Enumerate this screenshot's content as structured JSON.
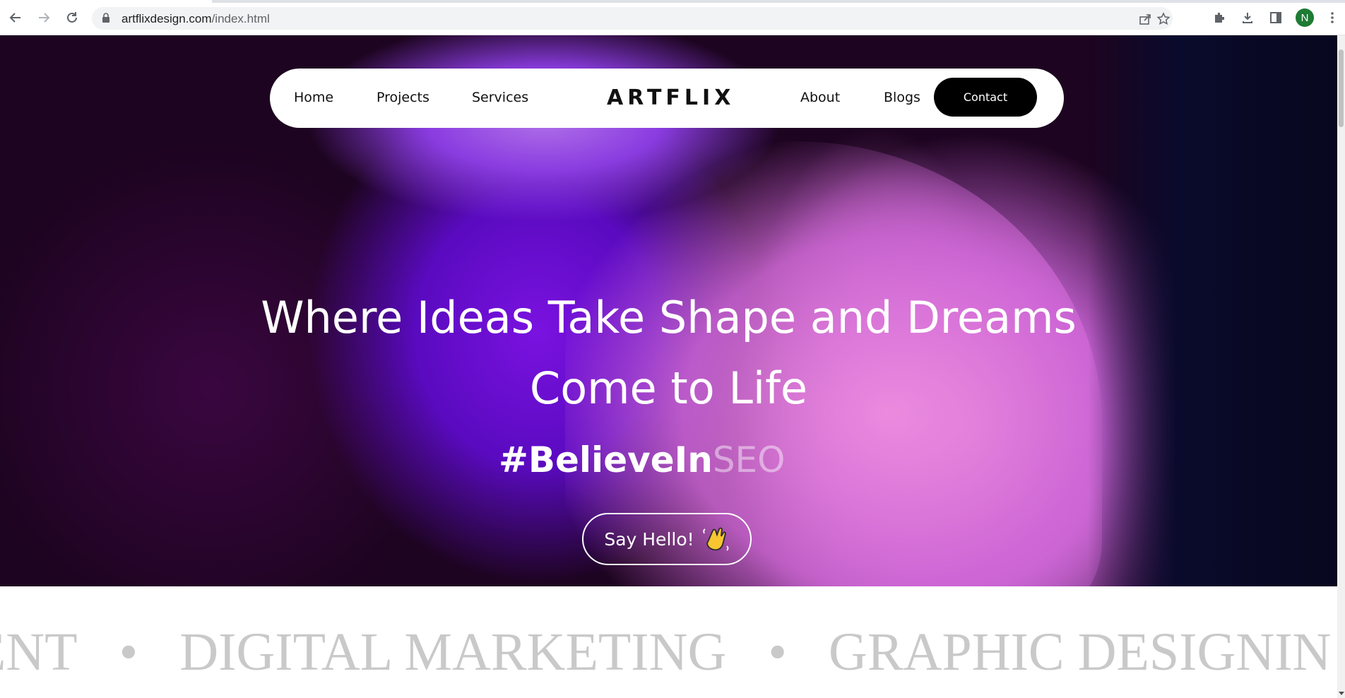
{
  "browser": {
    "url_domain": "artflixdesign.com",
    "url_path": "/index.html",
    "avatar_letter": "N"
  },
  "nav": {
    "home": "Home",
    "projects": "Projects",
    "services": "Services",
    "logo": "ARTFLIX",
    "about": "About",
    "blogs": "Blogs",
    "contact": "Contact"
  },
  "hero": {
    "headline_line1": "Where Ideas Take Shape and Dreams",
    "headline_line2": "Come to Life",
    "hashtag_main": "#BelieveIn",
    "hashtag_faded": "SEO",
    "cta_label": "Say Hello!"
  },
  "marquee": {
    "items": [
      "PMENT",
      "DIGITAL MARKETING",
      "GRAPHIC DESIGNIN"
    ],
    "separator": "•"
  },
  "colors": {
    "hero_purple": "#7a12e0",
    "hero_pink": "#e38ad9",
    "marquee_text": "#c9c9c9"
  }
}
